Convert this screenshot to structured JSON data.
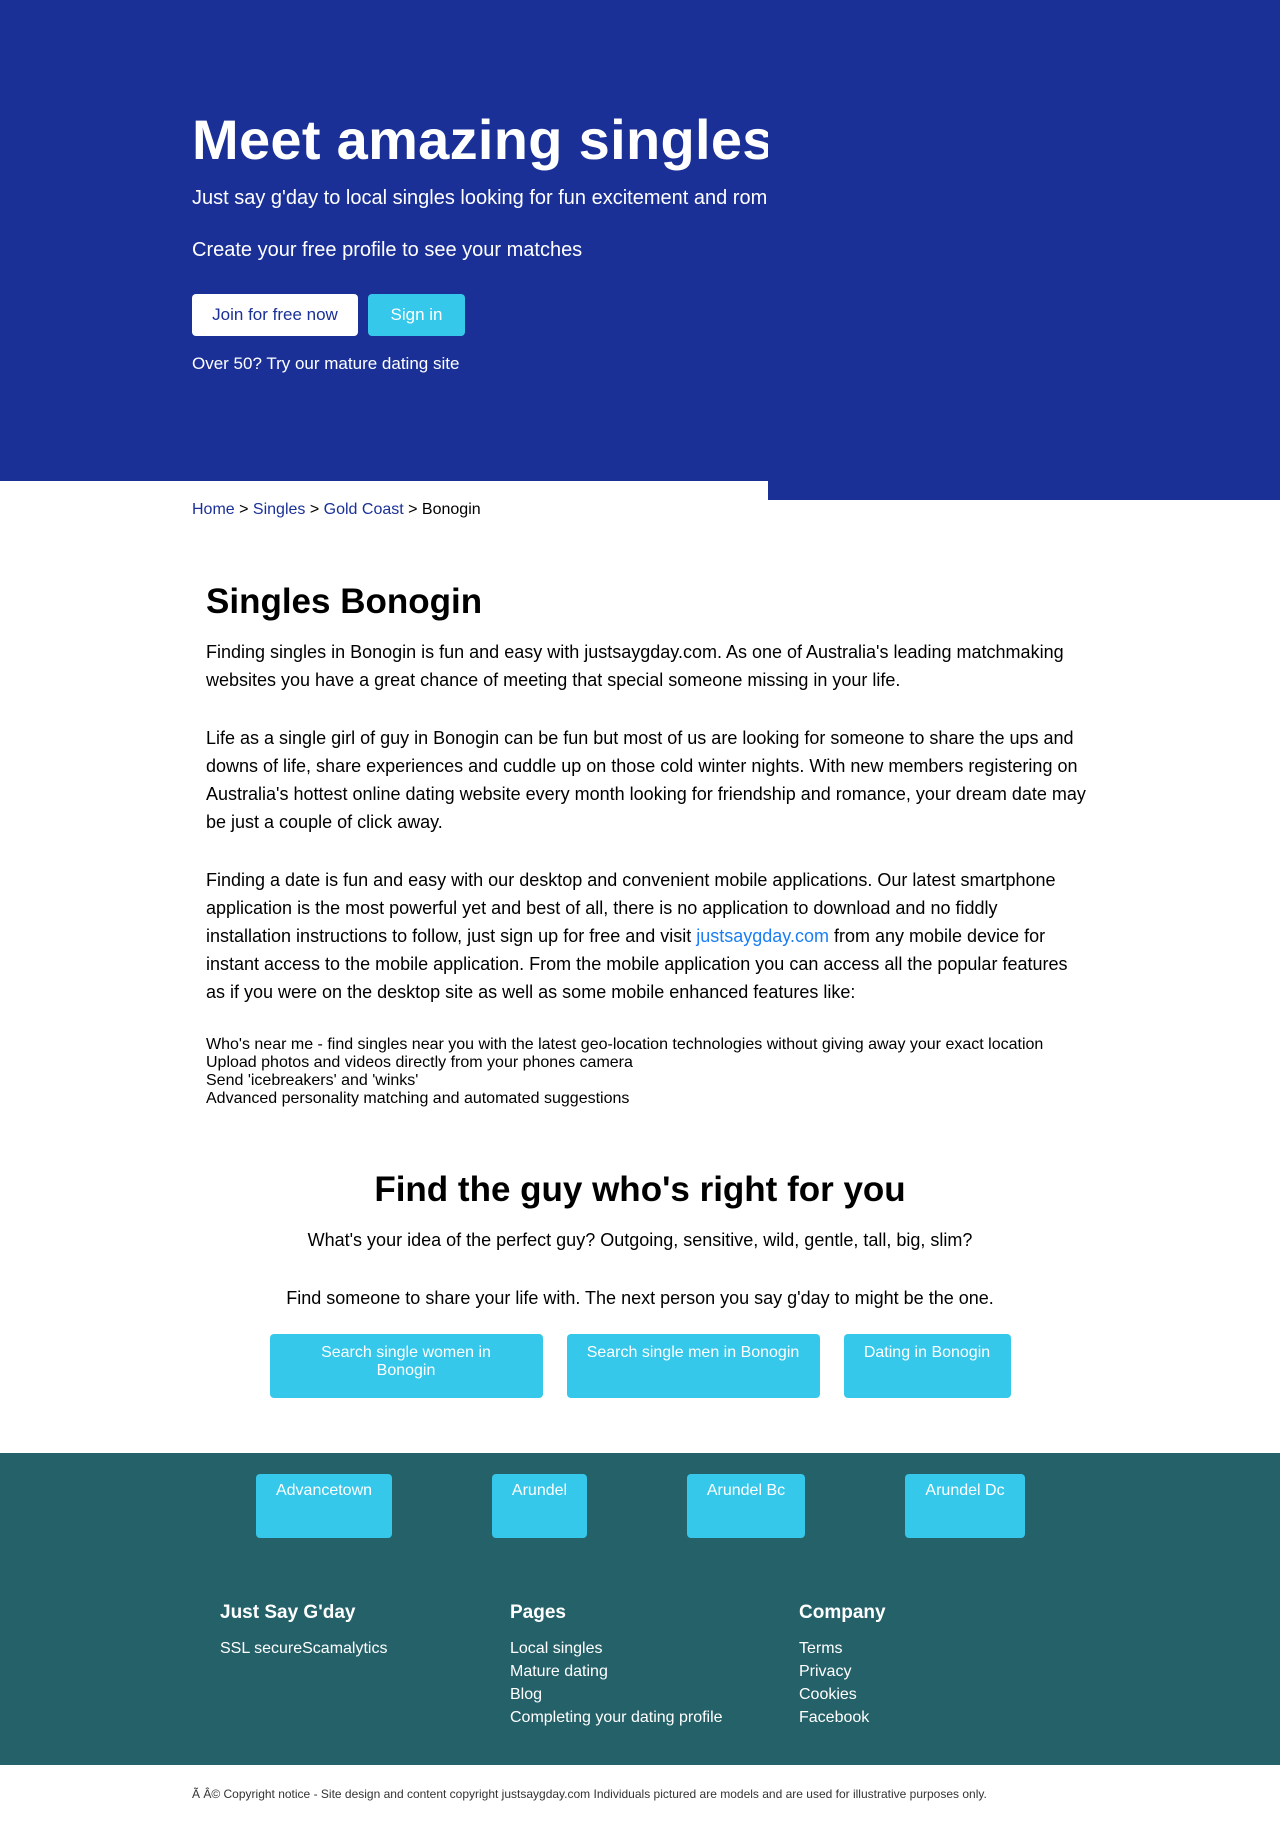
{
  "hero": {
    "title": "Meet amazing singles today",
    "subtitle": "Just say g'day to local singles looking for fun excitement and romance",
    "cta_text": "Create your free profile to see your matches",
    "join_label": "Join for free now",
    "signin_label": "Sign in",
    "mature_link": "Over 50? Try our mature dating site"
  },
  "breadcrumb": {
    "home": "Home",
    "sep1": " > ",
    "singles": "Singles",
    "sep2": " > ",
    "region": "Gold Coast",
    "sep3": " > ",
    "current": "Bonogin"
  },
  "main": {
    "title": "Singles Bonogin",
    "p1": "Finding singles in Bonogin is fun and easy with justsaygday.com. As one of Australia's leading matchmaking websites you have a great chance of meeting that special someone missing in your life.",
    "p2": "Life as a single girl of guy in Bonogin can be fun but most of us are looking for someone to share the ups and downs of life, share experiences and cuddle up on those cold winter nights. With new members registering on Australia's hottest online dating website every month looking for friendship and romance, your dream date may be just a couple of click away.",
    "p3_before": "Finding a date is fun and easy with our desktop and convenient mobile applications. Our latest smartphone application is the most powerful yet and best of all, there is no application to download and no fiddly installation instructions to follow, just sign up for free and visit ",
    "p3_link": "justsaygday.com",
    "p3_after": " from any mobile device for instant access to the mobile application. From the mobile application you can access all the popular features as if you were on the desktop site as well as some mobile enhanced features like:",
    "features": [
      "Who's near me - find singles near you with the latest geo-location technologies without giving away your exact location",
      "Upload photos and videos directly from your phones camera",
      "Send 'icebreakers' and 'winks'",
      "Advanced personality matching and automated suggestions"
    ]
  },
  "guy": {
    "title": "Find the guy who's right for you",
    "p1": "What's your idea of the perfect guy? Outgoing, sensitive, wild, gentle, tall, big, slim?",
    "p2": "Find someone to share your life with. The next person you say g'day to might be the one.",
    "buttons": [
      "Search single women in Bonogin",
      "Search single men in Bonogin",
      "Dating in Bonogin"
    ]
  },
  "footer": {
    "suburbs": [
      "Advancetown",
      "Arundel",
      "Arundel Bc",
      "Arundel Dc"
    ],
    "col1": {
      "title": "Just Say G'day",
      "text": "SSL secureScamalytics"
    },
    "col2": {
      "title": "Pages",
      "links": [
        "Local singles",
        "Mature dating",
        "Blog",
        "Completing your dating profile"
      ]
    },
    "col3": {
      "title": "Company",
      "links": [
        "Terms",
        "Privacy",
        "Cookies",
        "Facebook"
      ]
    }
  },
  "copyright": "Ã   Â© Copyright notice - Site design and content copyright justsaygday.com Individuals pictured are models and are used for illustrative purposes only.",
  "colors": {
    "hero_bg": "#1a3097",
    "accent": "#35c8ea",
    "footer_bg": "#256169",
    "link": "#1a3097",
    "inline_link": "#1a7ef2"
  }
}
